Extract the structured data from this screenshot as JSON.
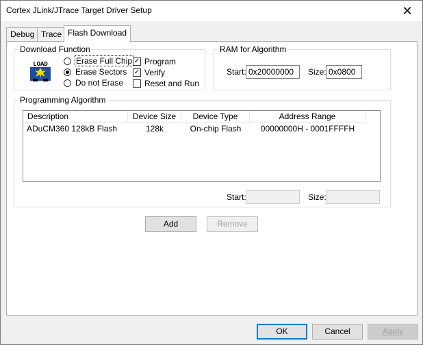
{
  "window": {
    "title": "Cortex JLink/JTrace Target Driver Setup",
    "close_glyph": "✕"
  },
  "tabs": [
    {
      "label": "Debug",
      "active": false
    },
    {
      "label": "Trace",
      "active": false
    },
    {
      "label": "Flash Download",
      "active": true
    }
  ],
  "download_function": {
    "label": "Download Function",
    "icon": "load-icon",
    "icon_text": "LOAD",
    "radios": [
      {
        "label": "Erase Full Chip",
        "checked": false
      },
      {
        "label": "Erase Sectors",
        "checked": true
      },
      {
        "label": "Do not Erase",
        "checked": false
      }
    ],
    "checks": [
      {
        "label": "Program",
        "checked": true
      },
      {
        "label": "Verify",
        "checked": true
      },
      {
        "label": "Reset and Run",
        "checked": false
      }
    ]
  },
  "ram": {
    "label": "RAM for Algorithm",
    "start_label": "Start:",
    "start_value": "0x20000000",
    "size_label": "Size:",
    "size_value": "0x0800"
  },
  "programming": {
    "label": "Programming Algorithm",
    "columns": [
      "Description",
      "Device Size",
      "Device Type",
      "Address Range"
    ],
    "rows": [
      {
        "description": "ADuCM360 128kB Flash",
        "size": "128k",
        "type": "On-chip Flash",
        "range": "00000000H - 0001FFFFH"
      }
    ],
    "start_label": "Start:",
    "start_value": "",
    "size_label": "Size:",
    "size_value": ""
  },
  "buttons": {
    "add": "Add",
    "remove": "Remove",
    "ok": "OK",
    "cancel": "Cancel",
    "apply": "Apply"
  },
  "colors": {
    "accent": "#0078d7",
    "icon_blue": "#1f4e9e",
    "icon_yellow": "#f5d800"
  }
}
